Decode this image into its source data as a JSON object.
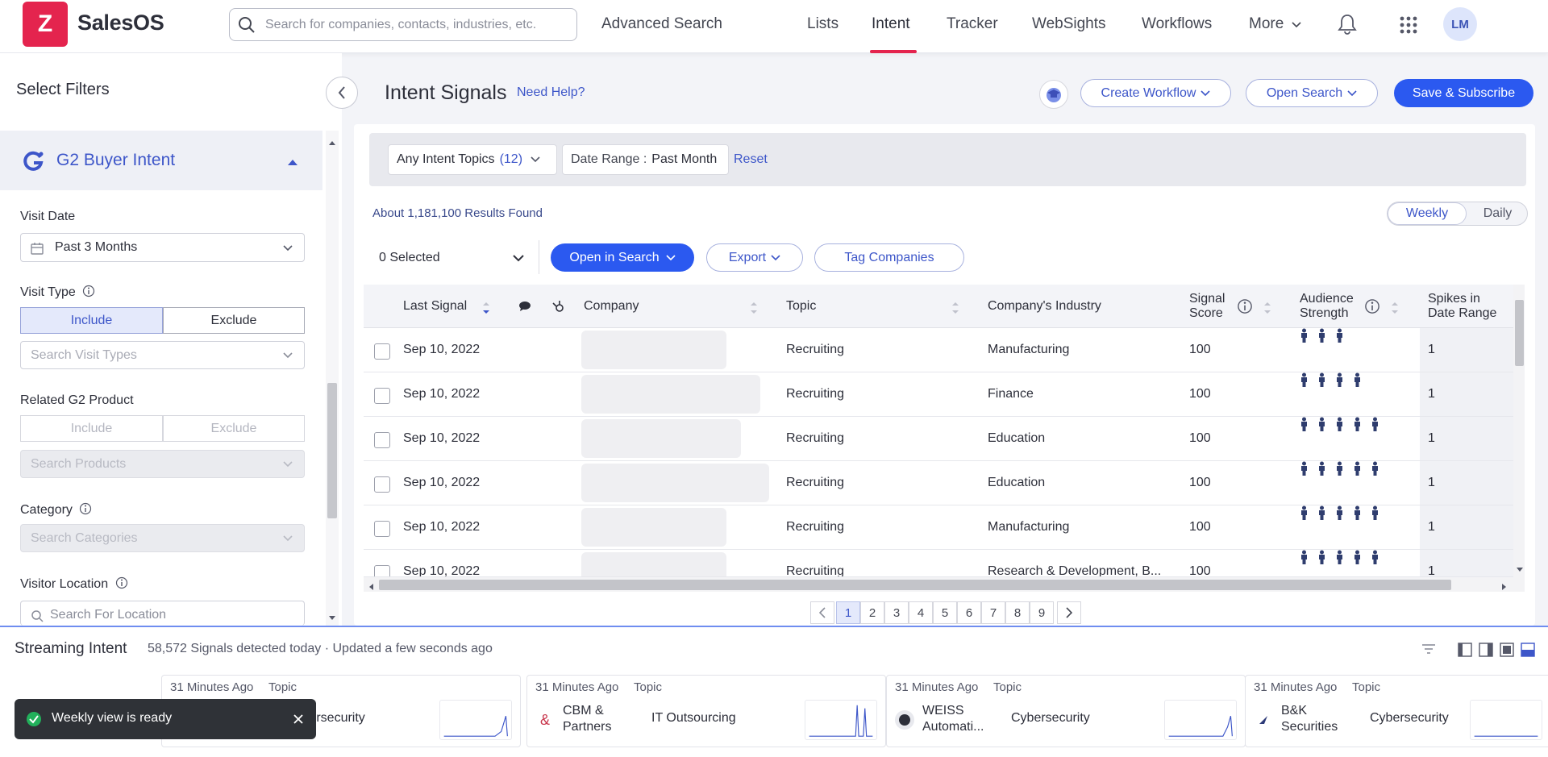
{
  "brand": {
    "logo_letter": "Z",
    "name": "SalesOS",
    "color": "#e4244e"
  },
  "search": {
    "placeholder": "Search for companies, contacts, industries, etc."
  },
  "nav": {
    "advanced_search": "Advanced Search",
    "lists": "Lists",
    "intent": "Intent",
    "tracker": "Tracker",
    "websights": "WebSights",
    "workflows": "Workflows",
    "more": "More",
    "avatar": "LM"
  },
  "sidebar": {
    "title": "Select Filters",
    "section": "G2 Buyer Intent",
    "visit_date": {
      "label": "Visit Date",
      "value": "Past 3 Months"
    },
    "visit_type": {
      "label": "Visit Type",
      "include": "Include",
      "exclude": "Exclude",
      "placeholder": "Search Visit Types"
    },
    "related_product": {
      "label": "Related G2 Product",
      "include": "Include",
      "exclude": "Exclude",
      "placeholder": "Search Products"
    },
    "category": {
      "label": "Category",
      "placeholder": "Search Categories"
    },
    "location": {
      "label": "Visitor Location",
      "placeholder": "Search For Location"
    }
  },
  "main": {
    "title": "Intent Signals",
    "need_help": "Need Help?",
    "create_workflow": "Create Workflow",
    "open_search": "Open Search",
    "save_subscribe": "Save & Subscribe",
    "topics_chip": "Any Intent Topics",
    "topics_count": "(12)",
    "date_label": "Date Range :",
    "date_value": "Past Month",
    "reset": "Reset",
    "results": "About 1,181,100 Results Found",
    "weekly": "Weekly",
    "daily": "Daily",
    "selected": "0 Selected",
    "open_in_search": "Open in Search",
    "export": "Export",
    "tag_companies": "Tag Companies"
  },
  "table": {
    "headers": {
      "last_signal": "Last Signal",
      "company": "Company",
      "topic": "Topic",
      "industry": "Company's Industry",
      "signal_score_1": "Signal",
      "signal_score_2": "Score",
      "audience_1": "Audience",
      "audience_2": "Strength",
      "spikes_1": "Spikes in",
      "spikes_2": "Date Range"
    },
    "rows": [
      {
        "date": "Sep 10, 2022",
        "topic": "Recruiting",
        "industry": "Manufacturing",
        "score": "100",
        "strength": 3,
        "spikes": "1"
      },
      {
        "date": "Sep 10, 2022",
        "topic": "Recruiting",
        "industry": "Finance",
        "score": "100",
        "strength": 4,
        "spikes": "1"
      },
      {
        "date": "Sep 10, 2022",
        "topic": "Recruiting",
        "industry": "Education",
        "score": "100",
        "strength": 5,
        "spikes": "1"
      },
      {
        "date": "Sep 10, 2022",
        "topic": "Recruiting",
        "industry": "Education",
        "score": "100",
        "strength": 5,
        "spikes": "1"
      },
      {
        "date": "Sep 10, 2022",
        "topic": "Recruiting",
        "industry": "Manufacturing",
        "score": "100",
        "strength": 5,
        "spikes": "1"
      },
      {
        "date": "Sep 10, 2022",
        "topic": "Recruiting",
        "industry": "Research & Development, B...",
        "score": "100",
        "strength": 5,
        "spikes": "1"
      }
    ]
  },
  "pagination": {
    "pages": [
      "1",
      "2",
      "3",
      "4",
      "5",
      "6",
      "7",
      "8",
      "9"
    ],
    "current": "1"
  },
  "streaming": {
    "title": "Streaming Intent",
    "subtitle": "58,572 Signals detected today · Updated a few seconds ago",
    "cards": [
      {
        "ago": "31 Minutes Ago",
        "topic_label": "Topic",
        "company": "",
        "topic": "Cybersecurity"
      },
      {
        "ago": "31 Minutes Ago",
        "topic_label": "Topic",
        "company": "CBM & Partners",
        "topic": "IT Outsourcing"
      },
      {
        "ago": "31 Minutes Ago",
        "topic_label": "Topic",
        "company": "WEISS Automati...",
        "topic": "Cybersecurity"
      },
      {
        "ago": "31 Minutes Ago",
        "topic_label": "Topic",
        "company": "B&K Securities",
        "topic": "Cybersecurity"
      }
    ]
  },
  "toast": {
    "message": "Weekly view is ready"
  },
  "colors": {
    "accent": "#2b59f0",
    "link": "#3d56c9",
    "brand": "#e4244e",
    "success": "#22b05b"
  }
}
